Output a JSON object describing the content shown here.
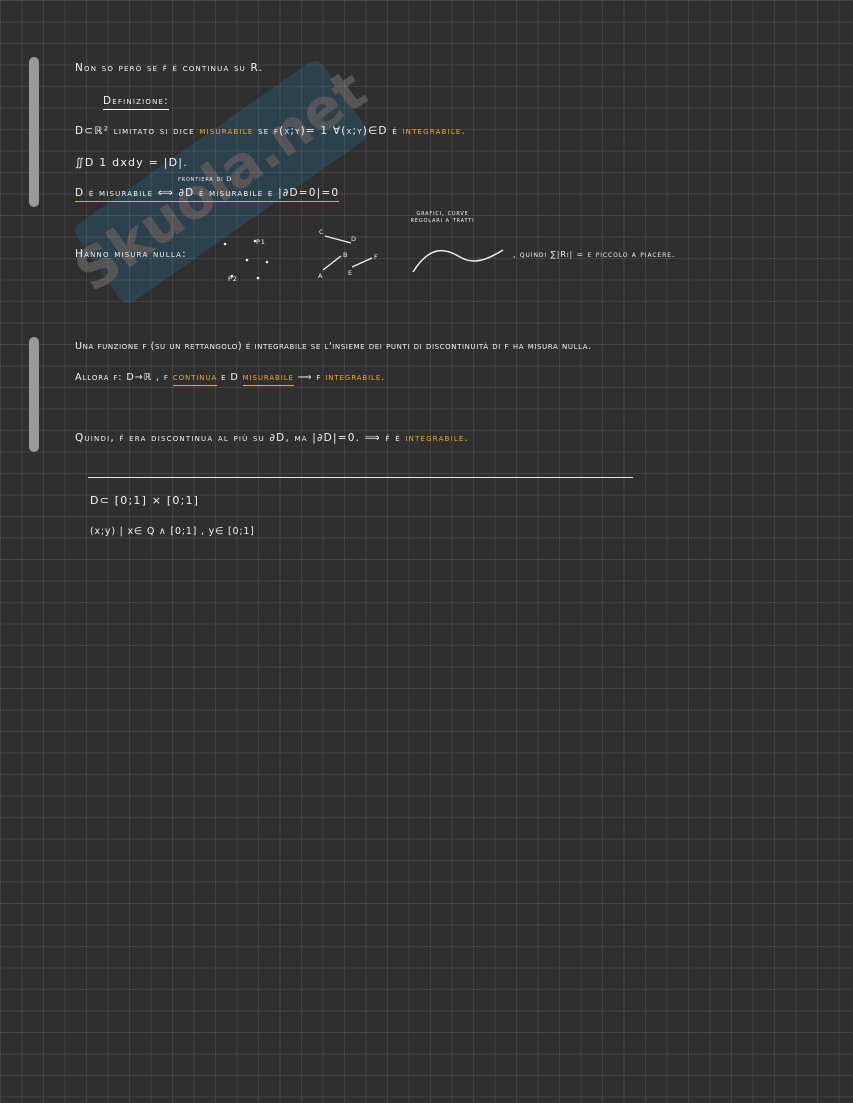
{
  "watermark": {
    "text": "Skuola.net"
  },
  "scrollbars": [
    {
      "name": "upper"
    },
    {
      "name": "lower"
    }
  ],
  "lines": {
    "l1": "Non so però se f̂ é continua su R.",
    "definizione": "Definizione:",
    "l3_a": "D⊂ℝ² limitato si dice",
    "l3_misurabile": "misurabile",
    "l3_b": "se f(x;y)= 1 ∀(x;y)∈D é",
    "l3_integrabile": "integrabile.",
    "l4": "∬D 1 dxdy = |D|.",
    "frontiera_note": "frontiera di D",
    "l5": "D é misurabile ⟺ ∂D é misurabile e |∂D=0|=0",
    "hanno": "Hanno misura nulla:",
    "grafici_note": "grafici, curve regolari a tratti",
    "quindi_ir": ", quindi ∑|Ri| = ε piccolo a piacere.",
    "dots": {
      "p1": "P1",
      "p2": "P2"
    },
    "segments": {
      "a": "A",
      "b": "B",
      "c": "C",
      "d": "D",
      "e": "E",
      "f": "F"
    },
    "l6": "Una funzione f (su un rettangolo) é integrabile se l'insieme dei punti di discontinuità di f ha misura nulla.",
    "l7_a": "Allora f: D→ℝ , f",
    "l7_continua": "continua",
    "l7_b": "e D",
    "l7_misurabile": "misurabile",
    "l7_c": "⟹ f",
    "l7_integrabile": "integrabile.",
    "l8_a": "Quindi, f̂ era discontinua al più su ∂D, ma |∂D|=0. ⟹ f̂ é",
    "l8_integrabile": "integrabile.",
    "ex1": "D⊂ [0;1] × [0;1]",
    "ex2": "(x;y) |  x∈ Q ∧ [0;1] , y∈ [0;1]"
  }
}
